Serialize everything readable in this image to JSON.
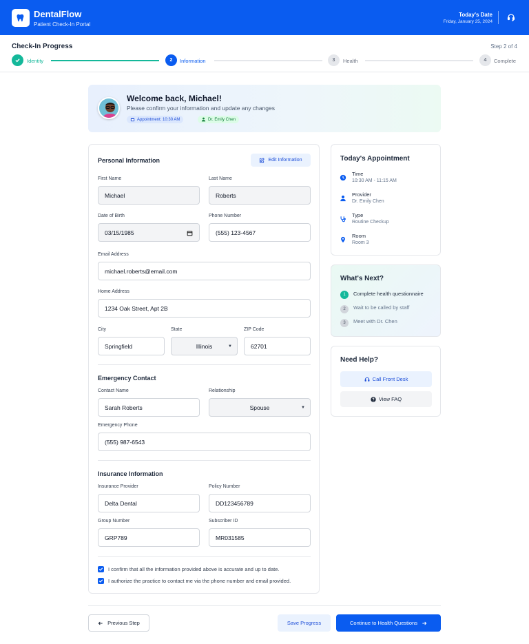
{
  "header": {
    "brand": "DentalFlow",
    "subtitle": "Patient Check-In Portal",
    "date_label": "Today's Date",
    "date_value": "Friday, January 25, 2024"
  },
  "progress": {
    "title": "Check-In Progress",
    "step_text": "Step 2 of 4",
    "steps": [
      {
        "num": "",
        "label": "Identity",
        "state": "complete"
      },
      {
        "num": "2",
        "label": "Information",
        "state": "active"
      },
      {
        "num": "3",
        "label": "Health",
        "state": "pending"
      },
      {
        "num": "4",
        "label": "Complete",
        "state": "pending"
      }
    ]
  },
  "welcome": {
    "title": "Welcome back, Michael!",
    "subtitle": "Please confirm your information and update any changes",
    "appointment_badge": "Appointment: 10:30 AM",
    "doctor_badge": "Dr. Emily Chen"
  },
  "personal": {
    "title": "Personal Information",
    "edit_label": "Edit Information",
    "first_name_label": "First Name",
    "first_name": "Michael",
    "last_name_label": "Last Name",
    "last_name": "Roberts",
    "dob_label": "Date of Birth",
    "dob": "03/15/1985",
    "phone_label": "Phone Number",
    "phone": "(555) 123-4567",
    "email_label": "Email Address",
    "email": "michael.roberts@email.com",
    "address_label": "Home Address",
    "address": "1234 Oak Street, Apt 2B",
    "city_label": "City",
    "city": "Springfield",
    "state_label": "State",
    "state": "Illinois",
    "zip_label": "ZIP Code",
    "zip": "62701"
  },
  "emergency": {
    "title": "Emergency Contact",
    "contact_label": "Contact Name",
    "contact": "Sarah Roberts",
    "relationship_label": "Relationship",
    "relationship": "Spouse",
    "phone_label": "Emergency Phone",
    "phone": "(555) 987-6543"
  },
  "insurance": {
    "title": "Insurance Information",
    "provider_label": "Insurance Provider",
    "provider": "Delta Dental",
    "policy_label": "Policy Number",
    "policy": "DD123456789",
    "group_label": "Group Number",
    "group": "GRP789",
    "subscriber_label": "Subscriber ID",
    "subscriber": "MR031585"
  },
  "consents": [
    "I confirm that all the information provided above is accurate and up to date.",
    "I authorize the practice to contact me via the phone number and email provided."
  ],
  "appointment": {
    "title": "Today's Appointment",
    "items": [
      {
        "label": "Time",
        "value": "10:30 AM - 11:15 AM",
        "icon": "clock-icon"
      },
      {
        "label": "Provider",
        "value": "Dr. Emily Chen",
        "icon": "user-icon"
      },
      {
        "label": "Type",
        "value": "Routine Checkup",
        "icon": "stethoscope-icon"
      },
      {
        "label": "Room",
        "value": "Room 3",
        "icon": "location-pin-icon"
      }
    ]
  },
  "next": {
    "title": "What's Next?",
    "items": [
      {
        "num": "1",
        "text": "Complete health questionnaire"
      },
      {
        "num": "2",
        "text": "Wait to be called by staff"
      },
      {
        "num": "3",
        "text": "Meet with Dr. Chen"
      }
    ]
  },
  "help": {
    "title": "Need Help?",
    "call_label": "Call Front Desk",
    "faq_label": "View FAQ"
  },
  "footer": {
    "prev_label": "Previous Step",
    "save_label": "Save Progress",
    "continue_label": "Continue to Health Questions"
  },
  "colors": {
    "primary": "#0a5cf0",
    "success": "#14b89a",
    "muted": "#9ca3af"
  }
}
